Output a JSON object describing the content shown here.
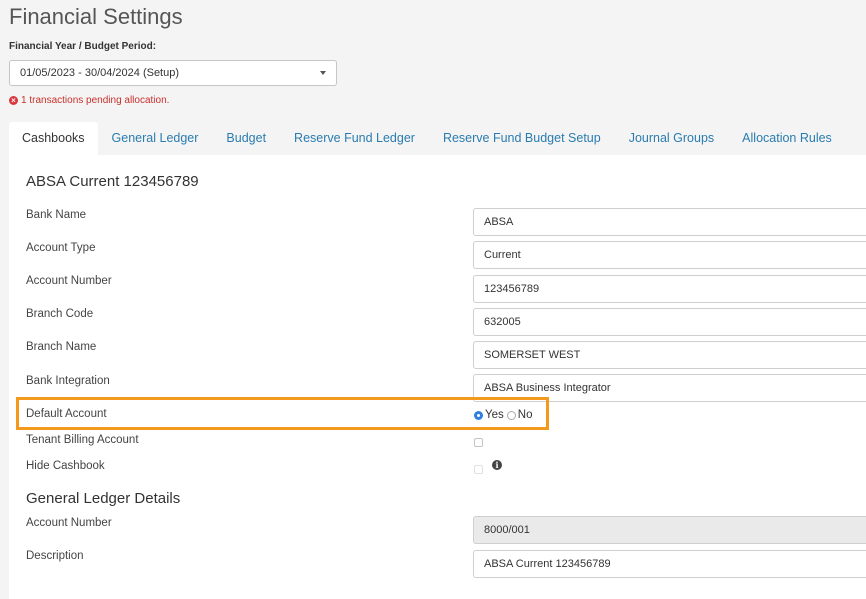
{
  "page": {
    "title": "Financial Settings",
    "fy_label": "Financial Year / Budget Period:",
    "fy_value": "01/05/2023 - 30/04/2024 (Setup)",
    "pending_message": "1 transactions pending allocation."
  },
  "tabs": [
    {
      "label": "Cashbooks",
      "active": true
    },
    {
      "label": "General Ledger"
    },
    {
      "label": "Budget"
    },
    {
      "label": "Reserve Fund Ledger"
    },
    {
      "label": "Reserve Fund Budget Setup"
    },
    {
      "label": "Journal Groups"
    },
    {
      "label": "Allocation Rules"
    }
  ],
  "cashbook": {
    "title": "ABSA Current 123456789",
    "bank_name": {
      "label": "Bank Name",
      "value": "ABSA"
    },
    "account_type": {
      "label": "Account Type",
      "value": "Current"
    },
    "account_number": {
      "label": "Account Number",
      "value": "123456789"
    },
    "branch_code": {
      "label": "Branch Code",
      "value": "632005"
    },
    "branch_name": {
      "label": "Branch Name",
      "value": "SOMERSET WEST"
    },
    "bank_integration": {
      "label": "Bank Integration",
      "value": "ABSA Business Integrator"
    },
    "default_account": {
      "label": "Default Account",
      "yes_label": "Yes",
      "no_label": "No",
      "selected": "Yes"
    },
    "tenant_billing": {
      "label": "Tenant Billing Account",
      "checked": false
    },
    "hide_cashbook": {
      "label": "Hide Cashbook",
      "checked": false
    }
  },
  "gl_details": {
    "title": "General Ledger Details",
    "account_number": {
      "label": "Account Number",
      "value": "8000/001"
    },
    "description": {
      "label": "Description",
      "value": "ABSA Current 123456789"
    }
  },
  "colors": {
    "link": "#2a7cb0",
    "highlight": "#f39a1c",
    "error": "#c9302c",
    "radio_selected": "#2f7fe0"
  }
}
